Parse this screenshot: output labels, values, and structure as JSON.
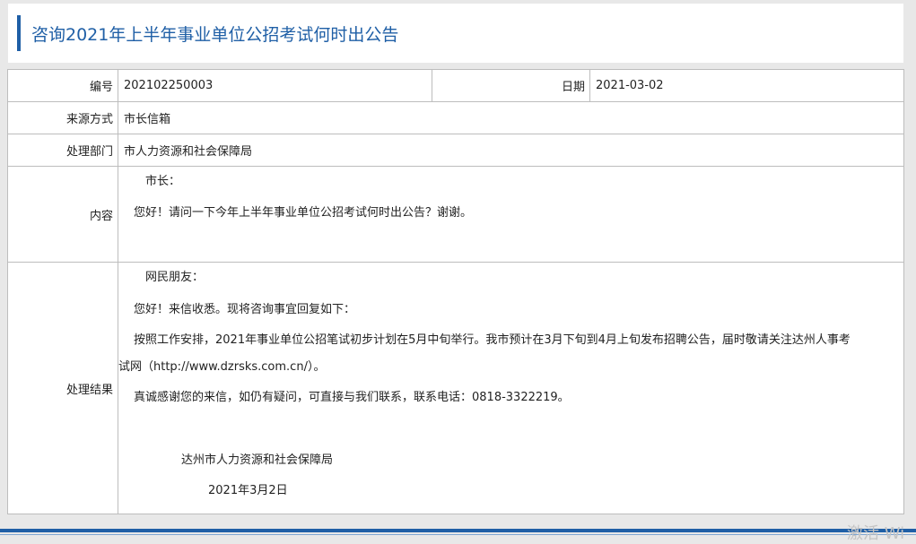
{
  "title": "咨询2021年上半年事业单位公招考试何时出公告",
  "fields": {
    "number_label": "编号",
    "number_value": "202102250003",
    "date_label": "日期",
    "date_value": "2021-03-02",
    "source_label": "来源方式",
    "source_value": "市长信箱",
    "dept_label": "处理部门",
    "dept_value": "市人力资源和社会保障局",
    "content_label": "内容",
    "result_label": "处理结果"
  },
  "content": {
    "salutation": "市长：",
    "body": "您好！请问一下今年上半年事业单位公招考试何时出公告？谢谢。"
  },
  "result": {
    "salutation": "网民朋友：",
    "line1": "您好！来信收悉。现将咨询事宜回复如下：",
    "line2a": "按照工作安排，2021年事业单位公招笔试初步计划在5月中旬举行。我市预计在3月下旬到4月上旬发布招聘公告，届时敬请关注达州人事考",
    "line2b": "试网（http://www.dzrsks.com.cn/）。",
    "line3": "真诚感谢您的来信，如仍有疑问，可直接与我们联系，联系电话：0818-3322219。",
    "signature": "达州市人力资源和社会保障局",
    "sign_date": "2021年3月2日"
  },
  "watermark": "激活 Wi",
  "colors": {
    "accent": "#1f5fa6",
    "border": "#bdbdbd",
    "background": "#e8e8e8"
  }
}
